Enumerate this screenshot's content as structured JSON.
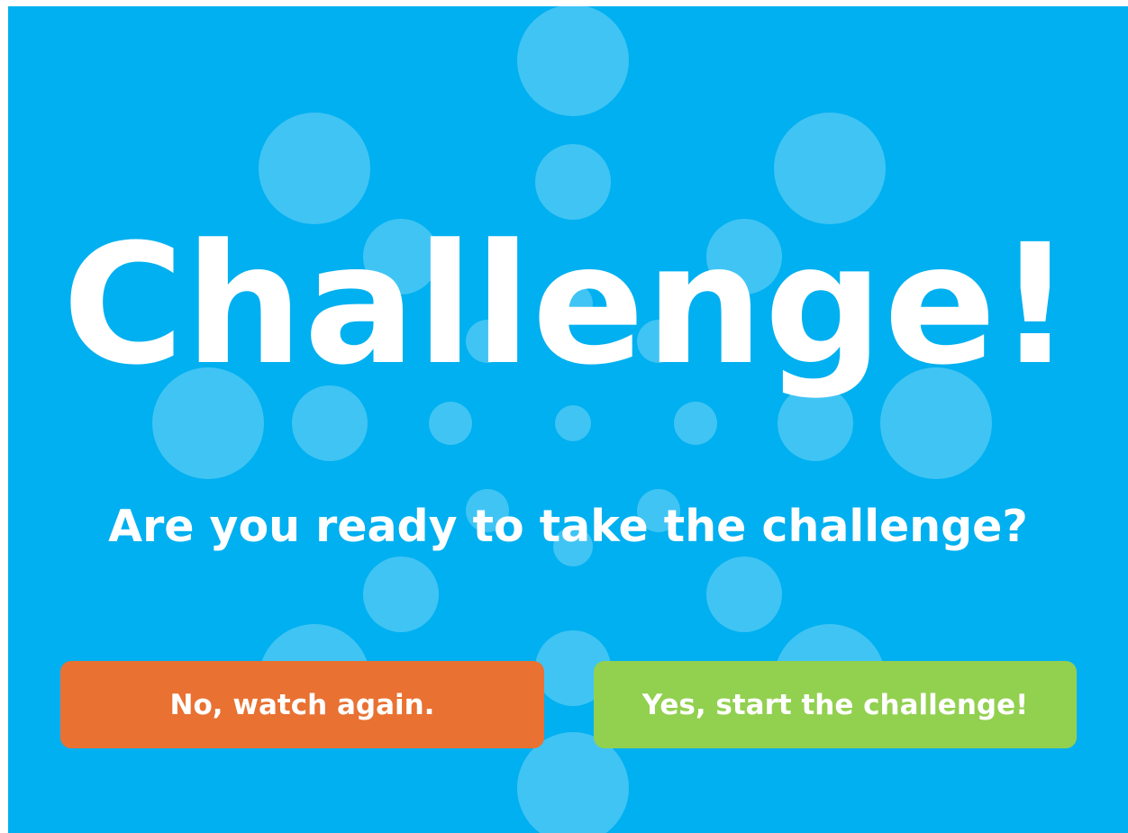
{
  "title": "Challenge!",
  "question": "Are you ready to take the challenge?",
  "buttons": {
    "no_label": "No, watch again.",
    "yes_label": "Yes, start the challenge!"
  },
  "colors": {
    "background": "#00b0f0",
    "dots": "#ffffff",
    "no_button": "#e97132",
    "yes_button": "#92d050",
    "text": "#ffffff"
  }
}
